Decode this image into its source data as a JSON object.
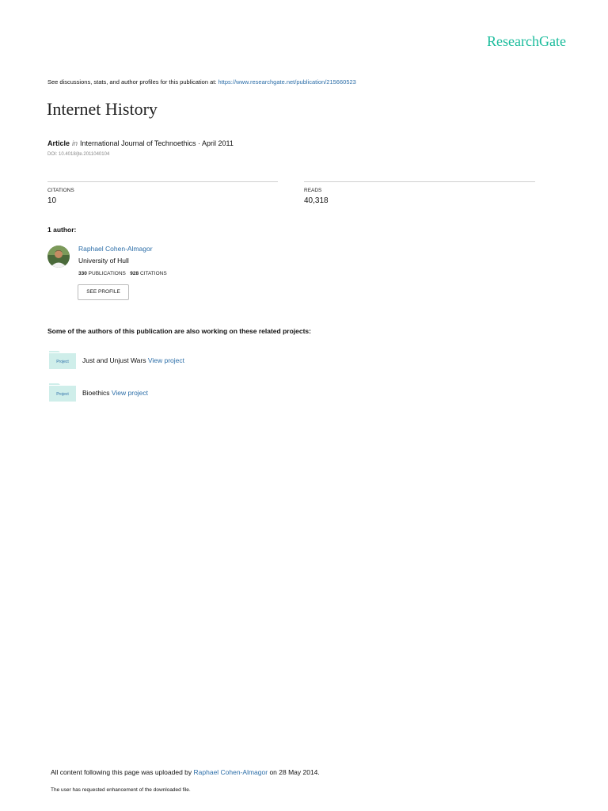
{
  "brand": {
    "name": "ResearchGate"
  },
  "discussion": {
    "text": "See discussions, stats, and author profiles for this publication at: ",
    "url": "https://www.researchgate.net/publication/215660523"
  },
  "publication": {
    "title": "Internet History",
    "type": "Article",
    "in_word": "in",
    "venue": "International Journal of Technoethics · April 2011",
    "doi": "DOI: 10.4018/jte.2011040104"
  },
  "stats": {
    "citations_label": "CITATIONS",
    "citations_value": "10",
    "reads_label": "READS",
    "reads_value": "40,318"
  },
  "authors": {
    "heading": "1 author:",
    "items": [
      {
        "name": "Raphael Cohen-Almagor",
        "institution": "University of Hull",
        "publications_count": "330",
        "publications_label": "PUBLICATIONS",
        "citations_count": "928",
        "citations_label": "CITATIONS",
        "profile_button": "SEE PROFILE"
      }
    ]
  },
  "projects": {
    "heading": "Some of the authors of this publication are also working on these related projects:",
    "icon_label": "Project",
    "items": [
      {
        "name": "Just and Unjust Wars",
        "link": "View project"
      },
      {
        "name": "Bioethics",
        "link": "View project"
      }
    ]
  },
  "footer": {
    "upload_prefix": "All content following this page was uploaded by ",
    "uploader": "Raphael Cohen-Almagor",
    "upload_suffix": " on 28 May 2014.",
    "note": "The user has requested enhancement of the downloaded file."
  },
  "colors": {
    "brand": "#1abc9c",
    "link": "#2c6ea8",
    "project_icon": "#cfeeea"
  }
}
